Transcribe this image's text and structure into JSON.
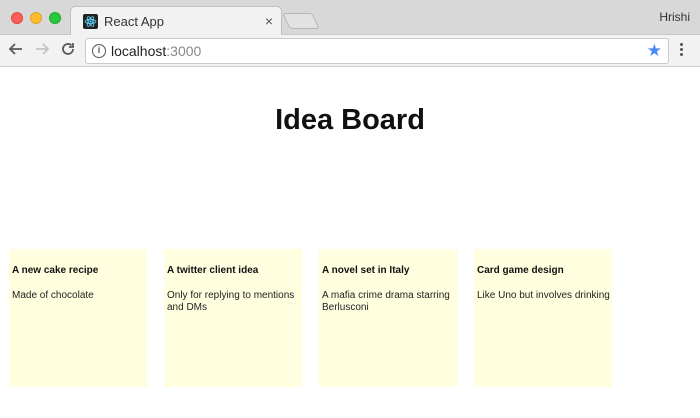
{
  "browser": {
    "tab": {
      "title": "React App",
      "close_glyph": "×"
    },
    "profile_name": "Hrishi",
    "url": {
      "host": "localhost",
      "port": ":3000"
    }
  },
  "page": {
    "title": "Idea Board",
    "ideas": [
      {
        "title": "A new cake recipe",
        "body": "Made of chocolate"
      },
      {
        "title": "A twitter client idea",
        "body": "Only for replying to mentions and DMs"
      },
      {
        "title": "A novel set in Italy",
        "body": "A mafia crime drama starring Berlusconi"
      },
      {
        "title": "Card game design",
        "body": "Like Uno but involves drinking"
      }
    ]
  },
  "colors": {
    "card_background": "#ffffe0",
    "star": "#4a8af4"
  },
  "icons": [
    "react-favicon-icon",
    "back-arrow-icon",
    "forward-arrow-icon",
    "reload-icon",
    "info-icon",
    "star-icon",
    "menu-dots-icon",
    "close-icon"
  ]
}
